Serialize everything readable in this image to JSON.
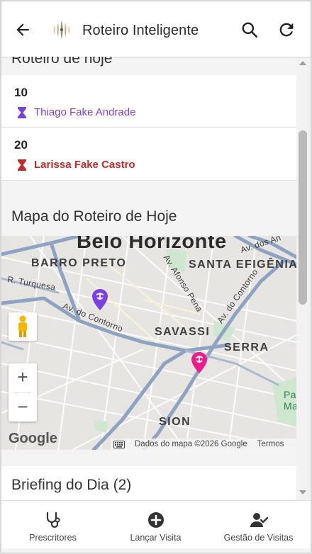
{
  "header": {
    "title": "Roteiro Inteligente",
    "icons": {
      "back": "arrow-back-icon",
      "logo": "brand-logo-icon",
      "search": "search-icon",
      "refresh": "refresh-icon"
    }
  },
  "today": {
    "title": "Roteiro de hoje",
    "items": [
      {
        "number": "10",
        "name": "Thiago Fake Andrade",
        "color": "#7b3fe4",
        "icon": "hourglass-icon"
      },
      {
        "number": "20",
        "name": "Larissa Fake Castro",
        "color": "#c62828",
        "icon": "hourglass-icon"
      }
    ]
  },
  "map_section": {
    "title": "Mapa do Roteiro de Hoje",
    "labels": {
      "city": "Belo Horizonte",
      "barro_preto": "BARRO PRETO",
      "santa_efigenia": "SANTA EFIGÊNIA",
      "savassi": "SAVASSI",
      "serra": "SERRA",
      "sion": "SION",
      "turquesa": "R. Turquesa",
      "contorno_w": "Av. do Contorno",
      "contorno_e": "Av. do Contorno",
      "afonso_pena": "Av. Afonso Pena",
      "av_dos_andradas": "Av. dos An",
      "pa_ma": "Pa\nMa"
    },
    "zoom_in": "+",
    "zoom_out": "−",
    "google": "Google",
    "attribution": {
      "data": "Dados do mapa ©2026 Google",
      "terms": "Termos"
    },
    "pins": [
      {
        "color": "#7b3fe4"
      },
      {
        "color": "#e91e8c"
      }
    ]
  },
  "briefing": {
    "title": "Briefing do Dia (2)"
  },
  "bottom_nav": [
    {
      "label": "Prescritores",
      "icon": "stethoscope-icon"
    },
    {
      "label": "Lançar Visita",
      "icon": "add-circle-icon"
    },
    {
      "label": "Gestão de Visitas",
      "icon": "user-check-icon"
    }
  ]
}
